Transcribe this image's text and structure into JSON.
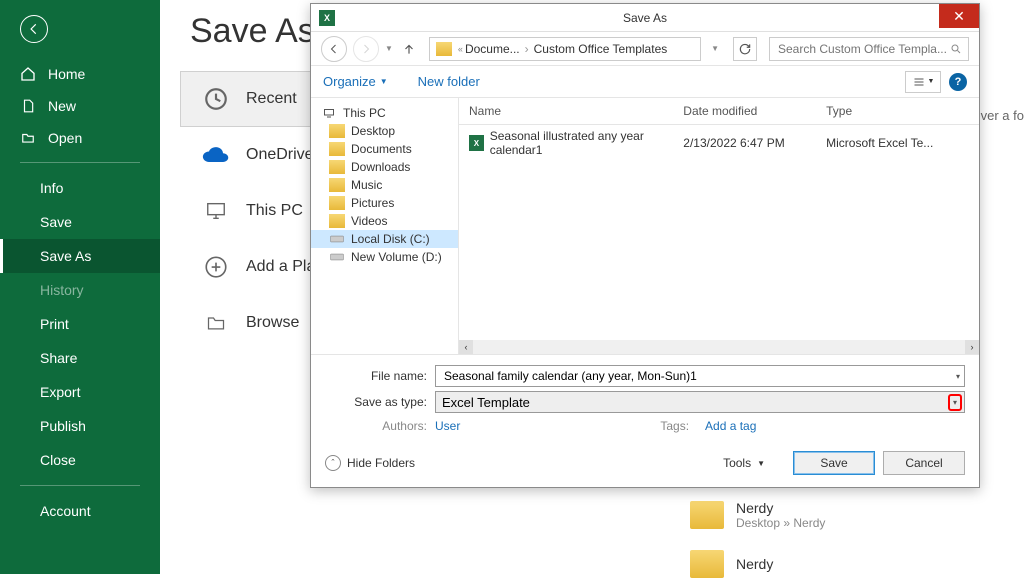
{
  "sidebar": {
    "home": "Home",
    "new": "New",
    "open": "Open",
    "info": "Info",
    "save": "Save",
    "save_as": "Save As",
    "history": "History",
    "print": "Print",
    "share": "Share",
    "export": "Export",
    "publish": "Publish",
    "close": "Close",
    "account": "Account"
  },
  "page": {
    "title": "Save As",
    "recent": "Recent",
    "onedrive": "OneDrive",
    "this_pc": "This PC",
    "add_place": "Add a Place",
    "browse": "Browse",
    "right_hint": "over a fo"
  },
  "recent_folders": [
    {
      "name": "Nerdy",
      "path": "Desktop » Nerdy"
    },
    {
      "name": "Nerdy",
      "path": ""
    }
  ],
  "dialog": {
    "title": "Save As",
    "crumb1": "Docume...",
    "crumb2": "Custom Office Templates",
    "search_placeholder": "Search Custom Office Templa...",
    "organize": "Organize",
    "new_folder": "New folder",
    "tree": {
      "root": "This PC",
      "items": [
        "Desktop",
        "Documents",
        "Downloads",
        "Music",
        "Pictures",
        "Videos",
        "Local Disk (C:)",
        "New Volume (D:)"
      ]
    },
    "columns": {
      "name": "Name",
      "date": "Date modified",
      "type": "Type"
    },
    "file": {
      "name": "Seasonal illustrated any year calendar1",
      "date": "2/13/2022 6:47 PM",
      "type": "Microsoft Excel Te..."
    },
    "file_name_label": "File name:",
    "file_name_value": "Seasonal family calendar (any year, Mon-Sun)1",
    "save_type_label": "Save as type:",
    "save_type_value": "Excel Template",
    "authors_label": "Authors:",
    "authors_value": "User",
    "tags_label": "Tags:",
    "tags_value": "Add a tag",
    "hide_folders": "Hide Folders",
    "tools": "Tools",
    "save_btn": "Save",
    "cancel_btn": "Cancel"
  }
}
